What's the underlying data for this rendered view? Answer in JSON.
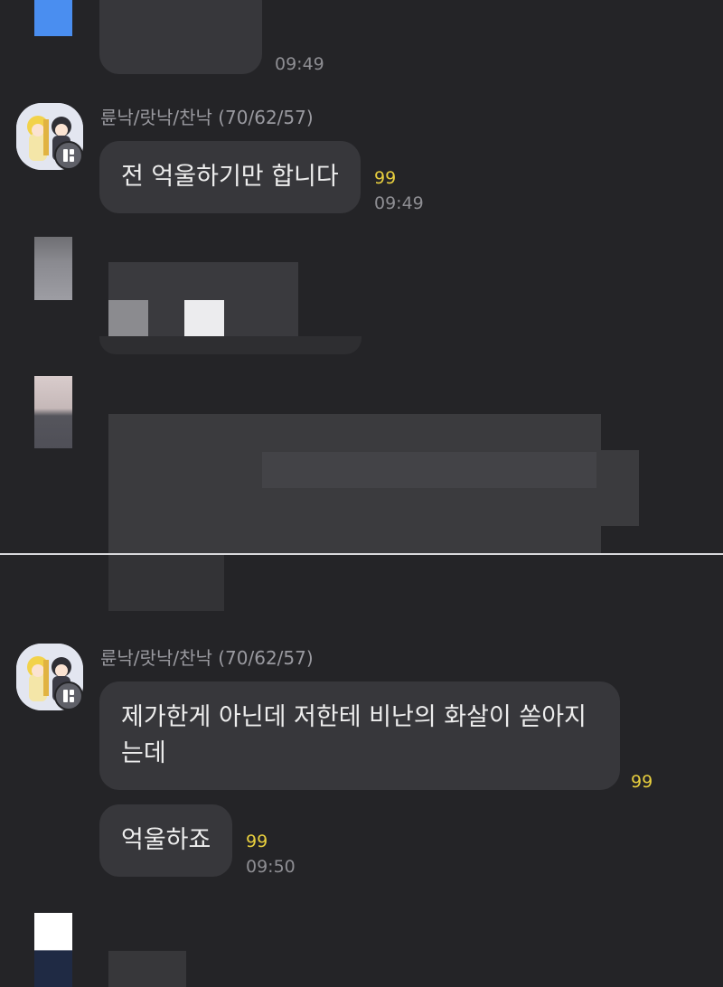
{
  "messages": [
    {
      "time": "09:49"
    },
    {
      "sender": "륜낙/랏낙/찬낙 (70/62/57)",
      "text": "전 억울하기만 합니다",
      "unread": "99",
      "time": "09:49"
    },
    {
      "sender": "륜낙/랏낙/찬낙 (70/62/57)",
      "text": "제가한게 아닌데 저한테 비난의 화살이 쏟아지\n는데",
      "unread": "99"
    },
    {
      "text": "억울하죠",
      "unread": "99",
      "time": "09:50"
    }
  ],
  "colors": {
    "background": "#242427",
    "bubble": "#37373b",
    "unread": "#e8cf3e",
    "time": "#8e8e93",
    "divider": "#d9d9dc"
  }
}
